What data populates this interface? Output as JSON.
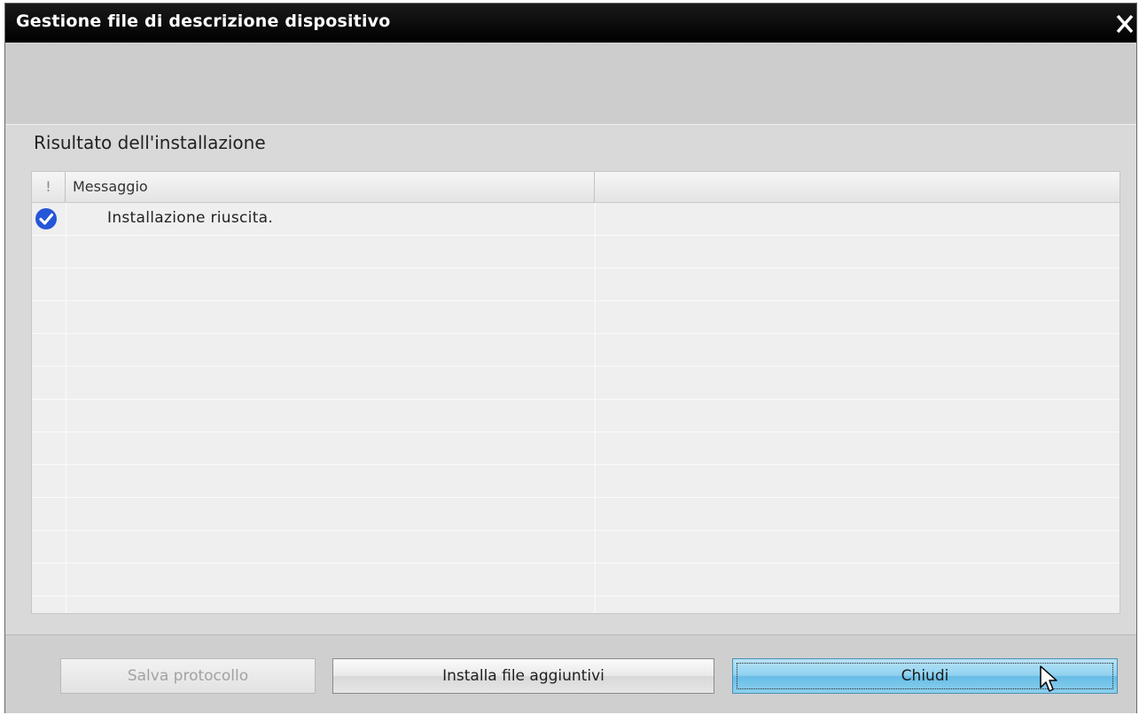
{
  "window": {
    "title": "Gestione file di descrizione dispositivo",
    "close_icon": "close-icon"
  },
  "section": {
    "title": "Risultato dell'installazione"
  },
  "table": {
    "columns": [
      {
        "label": "!"
      },
      {
        "label": "Messaggio"
      },
      {
        "label": ""
      }
    ],
    "rows": [
      {
        "status_icon": "check-circle-icon",
        "status_color": "#2456d8",
        "message": "Installazione riuscita."
      },
      {
        "status_icon": "",
        "message": ""
      },
      {
        "status_icon": "",
        "message": ""
      },
      {
        "status_icon": "",
        "message": ""
      },
      {
        "status_icon": "",
        "message": ""
      },
      {
        "status_icon": "",
        "message": ""
      },
      {
        "status_icon": "",
        "message": ""
      },
      {
        "status_icon": "",
        "message": ""
      },
      {
        "status_icon": "",
        "message": ""
      },
      {
        "status_icon": "",
        "message": ""
      },
      {
        "status_icon": "",
        "message": ""
      },
      {
        "status_icon": "",
        "message": ""
      },
      {
        "status_icon": "",
        "message": ""
      }
    ]
  },
  "footer": {
    "save_label": "Salva protocollo",
    "save_enabled": false,
    "install_label": "Installa file aggiuntivi",
    "close_label": "Chiudi"
  },
  "colors": {
    "titlebar": "#000000",
    "accent_button": "#8fd1ef",
    "success": "#2456d8"
  }
}
